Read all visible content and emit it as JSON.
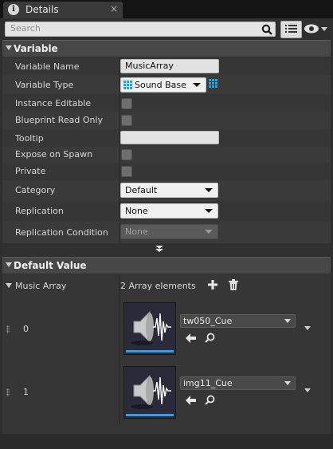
{
  "tab": {
    "title": "Details",
    "close": "×"
  },
  "search": {
    "placeholder": "Search"
  },
  "variable_section": {
    "title": "Variable",
    "rows": {
      "variable_name": {
        "label": "Variable Name",
        "value": "MusicArray"
      },
      "variable_type": {
        "label": "Variable Type",
        "value": "Sound Base"
      },
      "instance_editable": {
        "label": "Instance Editable"
      },
      "blueprint_read_only": {
        "label": "Blueprint Read Only"
      },
      "tooltip": {
        "label": "Tooltip",
        "value": ""
      },
      "expose_on_spawn": {
        "label": "Expose on Spawn"
      },
      "private": {
        "label": "Private"
      },
      "category": {
        "label": "Category",
        "value": "Default"
      },
      "replication": {
        "label": "Replication",
        "value": "None"
      },
      "replication_condition": {
        "label": "Replication Condition",
        "value": "None"
      }
    }
  },
  "default_section": {
    "title": "Default Value",
    "music_array": {
      "label": "Music Array",
      "count_text": "2 Array elements"
    },
    "elements": [
      {
        "index": "0",
        "asset": "tw050_Cue"
      },
      {
        "index": "1",
        "asset": "img11_Cue"
      }
    ]
  },
  "colors": {
    "accent": "#2ea2e8",
    "grid_icon": "#1ea6e6"
  }
}
